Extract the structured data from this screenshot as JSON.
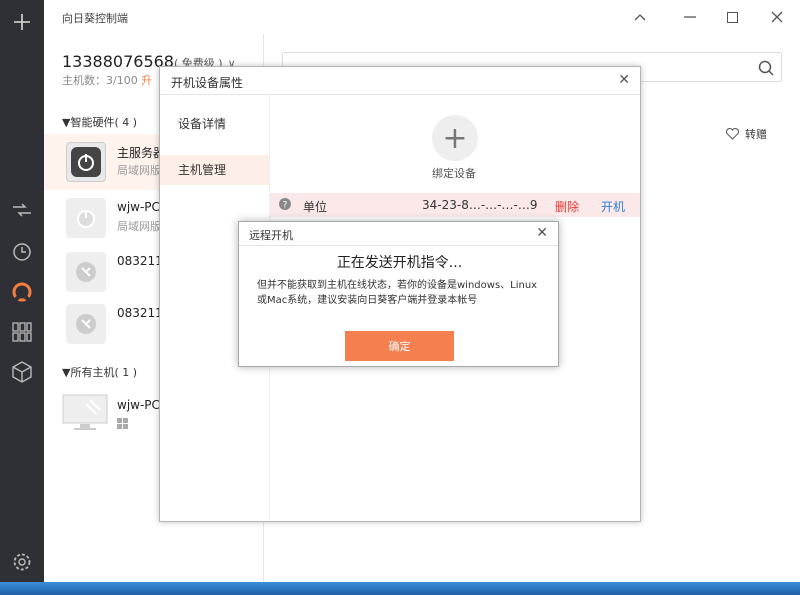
{
  "app": {
    "title": "向日葵控制端"
  },
  "account": {
    "phone": "13388076568",
    "tier": "( 免费级 )",
    "dropdown": "∨",
    "host_count": "主机数：3/100",
    "upgrade": "升"
  },
  "groups": {
    "smart": "▼智能硬件( 4 )",
    "all": "▼所有主机( 1 )"
  },
  "devices": [
    {
      "name": "主服务器",
      "sub": "局域网版"
    },
    {
      "name": "wjw-PC",
      "sub": "局域网版"
    },
    {
      "name": "083211",
      "sub": ""
    },
    {
      "name": "083211",
      "sub": ""
    }
  ],
  "hosts": [
    {
      "name": "wjw-PC"
    }
  ],
  "main": {
    "transfer": "转赠"
  },
  "dialog1": {
    "title": "开机设备属性",
    "tabs": [
      "设备详情",
      "主机管理"
    ],
    "bind_label": "绑定设备",
    "row": {
      "name": "单位",
      "mac": "34-23-8…-…-…-…9",
      "delete": "删除",
      "poweron": "开机"
    }
  },
  "dialog2": {
    "title": "远程开机",
    "heading": "正在发送开机指令...",
    "message": "但并不能获取到主机在线状态，若你的设备是windows、Linux或Mac系统，建议安装向日葵客户端并登录本帐号",
    "ok": "确定"
  },
  "colors": {
    "accent": "#f57f4f",
    "rail": "#2e3035",
    "danger": "#e53935",
    "link": "#2f7fd6"
  }
}
